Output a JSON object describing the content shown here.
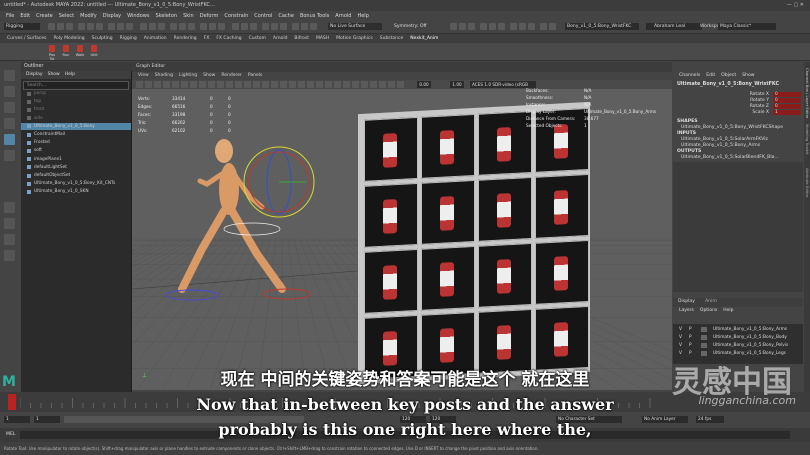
{
  "title_bar": {
    "title": "untitled* - Autodesk MAYA 2022: untitled --- Ultimate_Bony_v1_0_5:Bony_WristFKC..."
  },
  "menus": [
    "File",
    "Edit",
    "Create",
    "Select",
    "Modify",
    "Display",
    "Windows",
    "Skeleton",
    "Skin",
    "Deform",
    "Constrain",
    "Control",
    "Cache",
    "Bonus Tools",
    "Arnold",
    "Help"
  ],
  "status_line": {
    "mode": "Rigging",
    "live_surface": "No Live Surface",
    "symmetry": "Symmetry: Off",
    "selected_object": "Bony_v1_0_5:Bony_WristFKC",
    "user": "Abraham Leal",
    "workspace_label": "Workspace :",
    "workspace": "Maya Classic*"
  },
  "shelf_tabs": [
    "Curves / Surfaces",
    "Poly Modeling",
    "Sculpting",
    "Rigging",
    "Animation",
    "Rendering",
    "FX",
    "FX Caching",
    "Custom",
    "Arnold",
    "Bifrost",
    "MASH",
    "Motion Graphics",
    "Substance",
    "Nexkit_Anim"
  ],
  "shelf_buttons": [
    "Pos Tol",
    "Run",
    "Walk",
    "Utili"
  ],
  "outliner": {
    "title": "Outliner",
    "menu": [
      "Display",
      "Show",
      "Help"
    ],
    "search_placeholder": "Search...",
    "items": [
      "persp",
      "top",
      "front",
      "side",
      "Ultimate_Bony_v1_0_5:Bony",
      "ConstraintMail",
      "Frosted",
      "soft",
      "imagePlane1",
      "defaultLightSet",
      "defaultObjectSet",
      "Ultimate_Bony_v1_0_5:Bony_Kit_CNTs",
      "Ultimate_Bony_v1_0_SKN"
    ]
  },
  "viewport": {
    "panel_title": "Graph Editor",
    "menu": [
      "View",
      "Shading",
      "Lighting",
      "Show",
      "Renderer",
      "Panels"
    ],
    "field_a": "0.00",
    "field_b": "1.00",
    "colorspace": "ACES 1.0 SDR-video (sRGB",
    "hud_left": [
      {
        "label": "Verts:",
        "v1": "33414",
        "v2": "0",
        "v3": "0"
      },
      {
        "label": "Edges:",
        "v1": "66516",
        "v2": "0",
        "v3": "0"
      },
      {
        "label": "Faces:",
        "v1": "33198",
        "v2": "0",
        "v3": "0"
      },
      {
        "label": "Tris:",
        "v1": "66202",
        "v2": "0",
        "v3": "0"
      },
      {
        "label": "UVs:",
        "v1": "62102",
        "v2": "0",
        "v3": "0"
      }
    ],
    "hud_right": [
      {
        "label": "Backfaces:",
        "value": "N/A"
      },
      {
        "label": "Smoothness:",
        "value": "N/A"
      },
      {
        "label": "Instance:",
        "value": "N/A"
      },
      {
        "label": "Display Layer:",
        "value": "Ultimate_Bony_v1_0_5:Bony_Arms"
      },
      {
        "label": "Distance From Camera:",
        "value": "38.677"
      },
      {
        "label": "Selected Objects:",
        "value": "1"
      }
    ]
  },
  "channel_box": {
    "menu": [
      "Channels",
      "Edit",
      "Object",
      "Show"
    ],
    "object": "Ultimate_Bony_v1_0_5:Bony_WristFKC",
    "attrs": [
      {
        "name": "Rotate X",
        "value": "0"
      },
      {
        "name": "Rotate Y",
        "value": "0"
      },
      {
        "name": "Rotate Z",
        "value": "0"
      },
      {
        "name": "Scale X",
        "value": "1"
      }
    ],
    "shapes_header": "SHAPES",
    "shapes": [
      "Ultimate_Bony_v1_0_5:Bony_WristFKCShape"
    ],
    "inputs_header": "INPUTS",
    "inputs": [
      "Ultimate_Bony_v1_0_5:SolarArmFKViz",
      "Ultimate_Bony_v1_0_5:Bony_Arms"
    ],
    "outputs_header": "OUTPUTS",
    "outputs": [
      "Ultimate_Bony_v1_0_5:SolarBlendFK_Bla..."
    ],
    "side_tabs": [
      "Channel Box / Layer Editor",
      "Modeling Toolkit",
      "Attribute Editor"
    ]
  },
  "layer_editor": {
    "tabs": [
      "Display",
      "Anim"
    ],
    "menu": [
      "Layers",
      "Options",
      "Help"
    ],
    "layers": [
      {
        "v": "V",
        "p": "P",
        "name": "Ultimate_Bony_v1_0_5:Bony_Arms"
      },
      {
        "v": "V",
        "p": "P",
        "name": "Ultimate_Bony_v1_0_5:Bony_Body"
      },
      {
        "v": "V",
        "p": "P",
        "name": "Ultimate_Bony_v1_0_5:Bony_Pelvis"
      },
      {
        "v": "V",
        "p": "P",
        "name": "Ultimate_Bony_v1_0_5:Bony_Legs"
      }
    ]
  },
  "range": {
    "start": "1",
    "start2": "1",
    "end": "120",
    "end2": "120",
    "char_set": "No Character Set",
    "anim_layer": "No Anim Layer",
    "fps": "24 fps"
  },
  "command_line": {
    "label": "MEL"
  },
  "help_line": "Rotate Tool: Use manipulator to rotate object(s). Shift+drag manipulator axis or plane handles to extrude components or clone objects. Ctrl+Shift+LMB+drag to constrain rotation to connected edges. Use D or INSERT to change the pivot position and axis orientation.",
  "subtitles": {
    "zh": "现在 中间的关键姿势和答案可能是这个 就在这里",
    "en1": "Now that in-between key posts and the answer",
    "en2": "probably is this one right here where the,"
  },
  "watermark": {
    "cn": "灵感中国",
    "url": "lingganchina.com"
  },
  "colors": {
    "accent_red": "#c0392b",
    "selection_green": "#5d9d3b",
    "timeline_red": "#b22"
  }
}
